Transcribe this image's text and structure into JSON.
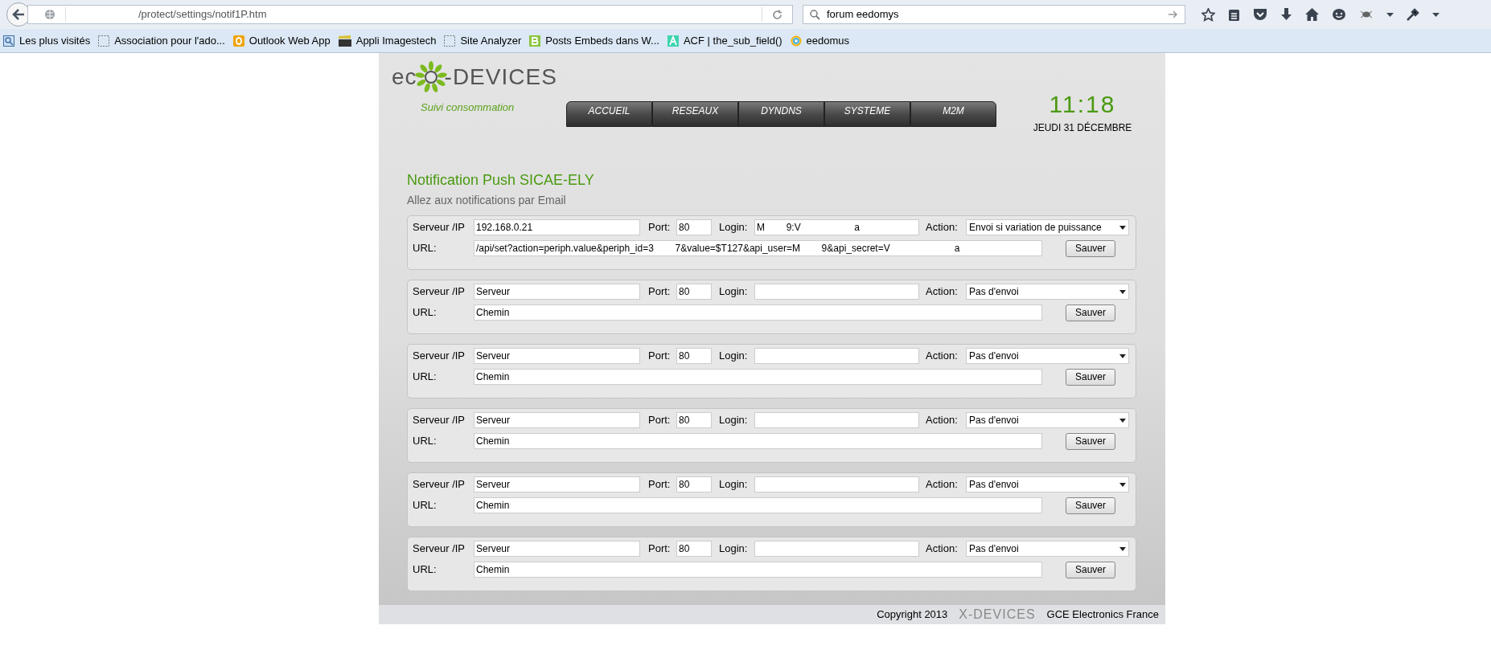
{
  "browser": {
    "url": "/protect/settings/notif1P.htm",
    "search": "forum eedomys",
    "bookmarks": [
      {
        "kind": "search",
        "label": "Les plus visités"
      },
      {
        "kind": "blank",
        "label": "Association pour l'ado..."
      },
      {
        "kind": "outlook",
        "label": "Outlook Web App"
      },
      {
        "kind": "clapper",
        "label": "Appli Imagestech"
      },
      {
        "kind": "blank",
        "label": "Site Analyzer"
      },
      {
        "kind": "b",
        "label": "Posts Embeds dans W..."
      },
      {
        "kind": "a",
        "label": "ACF | the_sub_field()"
      },
      {
        "kind": "ring",
        "label": "eedomus"
      }
    ]
  },
  "header": {
    "logo_prefix": "ec",
    "logo_suffix": "-DEVICES",
    "tagline": "Suivi consommation",
    "time": "11:18",
    "date": "JEUDI 31 DÉCEMBRE",
    "tabs": [
      "ACCUEIL",
      "RESEAUX",
      "DYNDNS",
      "SYSTEME",
      "M2M"
    ]
  },
  "title": "Notification Push SICAE-ELY",
  "subtitle": "Allez aux notifications par Email",
  "blocks": [
    {
      "server_label": "Serveur /IP",
      "server": "192.168.0.21",
      "port_label": "Port:",
      "port": "80",
      "login_label": "Login:",
      "login": "M        9:V                    a",
      "action_label": "Action:",
      "action": "Envoi si variation de puissance",
      "url_label": "URL:",
      "url": "/api/set?action=periph.value&periph_id=3        7&value=$T127&api_user=M        9&api_secret=V                        a",
      "button": "Sauver"
    },
    {
      "server_label": "Serveur /IP",
      "server": "Serveur",
      "port_label": "Port:",
      "port": "80",
      "login_label": "Login:",
      "action_label": "Action:",
      "action": "Pas d'envoi",
      "url_label": "URL:",
      "url": "Chemin",
      "button": "Sauver"
    },
    {
      "server_label": "Serveur /IP",
      "server": "Serveur",
      "port_label": "Port:",
      "port": "80",
      "login_label": "Login:",
      "action_label": "Action:",
      "action": "Pas d'envoi",
      "url_label": "URL:",
      "url": "Chemin",
      "button": "Sauver"
    },
    {
      "server_label": "Serveur /IP",
      "server": "Serveur",
      "port_label": "Port:",
      "port": "80",
      "login_label": "Login:",
      "action_label": "Action:",
      "action": "Pas d'envoi",
      "url_label": "URL:",
      "url": "Chemin",
      "button": "Sauver"
    },
    {
      "server_label": "Serveur /IP",
      "server": "Serveur",
      "port_label": "Port:",
      "port": "80",
      "login_label": "Login:",
      "action_label": "Action:",
      "action": "Pas d'envoi",
      "url_label": "URL:",
      "url": "Chemin",
      "button": "Sauver"
    },
    {
      "server_label": "Serveur /IP",
      "server": "Serveur",
      "port_label": "Port:",
      "port": "80",
      "login_label": "Login:",
      "action_label": "Action:",
      "action": "Pas d'envoi",
      "url_label": "URL:",
      "url": "Chemin",
      "button": "Sauver"
    }
  ],
  "footer": {
    "copyright": "Copyright 2013",
    "brand": "X-DEVICES",
    "company": "GCE Electronics France"
  }
}
